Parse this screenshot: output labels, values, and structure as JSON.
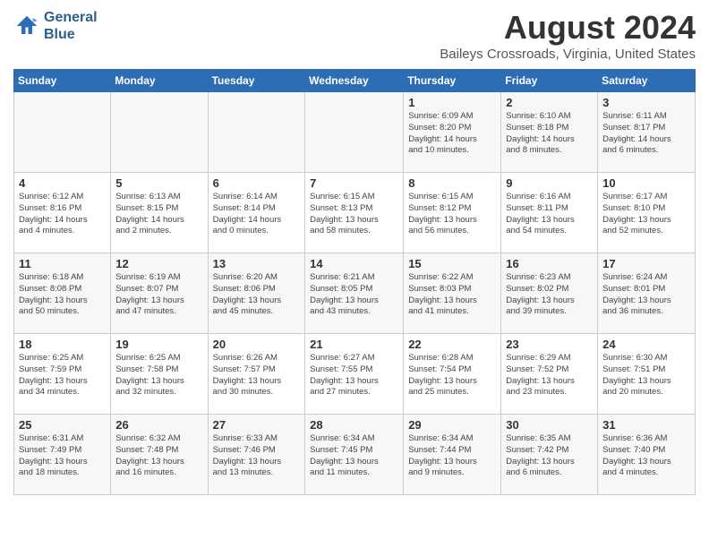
{
  "logo": {
    "line1": "General",
    "line2": "Blue"
  },
  "title": "August 2024",
  "location": "Baileys Crossroads, Virginia, United States",
  "days_of_week": [
    "Sunday",
    "Monday",
    "Tuesday",
    "Wednesday",
    "Thursday",
    "Friday",
    "Saturday"
  ],
  "weeks": [
    [
      {
        "day": "",
        "text": ""
      },
      {
        "day": "",
        "text": ""
      },
      {
        "day": "",
        "text": ""
      },
      {
        "day": "",
        "text": ""
      },
      {
        "day": "1",
        "text": "Sunrise: 6:09 AM\nSunset: 8:20 PM\nDaylight: 14 hours\nand 10 minutes."
      },
      {
        "day": "2",
        "text": "Sunrise: 6:10 AM\nSunset: 8:18 PM\nDaylight: 14 hours\nand 8 minutes."
      },
      {
        "day": "3",
        "text": "Sunrise: 6:11 AM\nSunset: 8:17 PM\nDaylight: 14 hours\nand 6 minutes."
      }
    ],
    [
      {
        "day": "4",
        "text": "Sunrise: 6:12 AM\nSunset: 8:16 PM\nDaylight: 14 hours\nand 4 minutes."
      },
      {
        "day": "5",
        "text": "Sunrise: 6:13 AM\nSunset: 8:15 PM\nDaylight: 14 hours\nand 2 minutes."
      },
      {
        "day": "6",
        "text": "Sunrise: 6:14 AM\nSunset: 8:14 PM\nDaylight: 14 hours\nand 0 minutes."
      },
      {
        "day": "7",
        "text": "Sunrise: 6:15 AM\nSunset: 8:13 PM\nDaylight: 13 hours\nand 58 minutes."
      },
      {
        "day": "8",
        "text": "Sunrise: 6:15 AM\nSunset: 8:12 PM\nDaylight: 13 hours\nand 56 minutes."
      },
      {
        "day": "9",
        "text": "Sunrise: 6:16 AM\nSunset: 8:11 PM\nDaylight: 13 hours\nand 54 minutes."
      },
      {
        "day": "10",
        "text": "Sunrise: 6:17 AM\nSunset: 8:10 PM\nDaylight: 13 hours\nand 52 minutes."
      }
    ],
    [
      {
        "day": "11",
        "text": "Sunrise: 6:18 AM\nSunset: 8:08 PM\nDaylight: 13 hours\nand 50 minutes."
      },
      {
        "day": "12",
        "text": "Sunrise: 6:19 AM\nSunset: 8:07 PM\nDaylight: 13 hours\nand 47 minutes."
      },
      {
        "day": "13",
        "text": "Sunrise: 6:20 AM\nSunset: 8:06 PM\nDaylight: 13 hours\nand 45 minutes."
      },
      {
        "day": "14",
        "text": "Sunrise: 6:21 AM\nSunset: 8:05 PM\nDaylight: 13 hours\nand 43 minutes."
      },
      {
        "day": "15",
        "text": "Sunrise: 6:22 AM\nSunset: 8:03 PM\nDaylight: 13 hours\nand 41 minutes."
      },
      {
        "day": "16",
        "text": "Sunrise: 6:23 AM\nSunset: 8:02 PM\nDaylight: 13 hours\nand 39 minutes."
      },
      {
        "day": "17",
        "text": "Sunrise: 6:24 AM\nSunset: 8:01 PM\nDaylight: 13 hours\nand 36 minutes."
      }
    ],
    [
      {
        "day": "18",
        "text": "Sunrise: 6:25 AM\nSunset: 7:59 PM\nDaylight: 13 hours\nand 34 minutes."
      },
      {
        "day": "19",
        "text": "Sunrise: 6:25 AM\nSunset: 7:58 PM\nDaylight: 13 hours\nand 32 minutes."
      },
      {
        "day": "20",
        "text": "Sunrise: 6:26 AM\nSunset: 7:57 PM\nDaylight: 13 hours\nand 30 minutes."
      },
      {
        "day": "21",
        "text": "Sunrise: 6:27 AM\nSunset: 7:55 PM\nDaylight: 13 hours\nand 27 minutes."
      },
      {
        "day": "22",
        "text": "Sunrise: 6:28 AM\nSunset: 7:54 PM\nDaylight: 13 hours\nand 25 minutes."
      },
      {
        "day": "23",
        "text": "Sunrise: 6:29 AM\nSunset: 7:52 PM\nDaylight: 13 hours\nand 23 minutes."
      },
      {
        "day": "24",
        "text": "Sunrise: 6:30 AM\nSunset: 7:51 PM\nDaylight: 13 hours\nand 20 minutes."
      }
    ],
    [
      {
        "day": "25",
        "text": "Sunrise: 6:31 AM\nSunset: 7:49 PM\nDaylight: 13 hours\nand 18 minutes."
      },
      {
        "day": "26",
        "text": "Sunrise: 6:32 AM\nSunset: 7:48 PM\nDaylight: 13 hours\nand 16 minutes."
      },
      {
        "day": "27",
        "text": "Sunrise: 6:33 AM\nSunset: 7:46 PM\nDaylight: 13 hours\nand 13 minutes."
      },
      {
        "day": "28",
        "text": "Sunrise: 6:34 AM\nSunset: 7:45 PM\nDaylight: 13 hours\nand 11 minutes."
      },
      {
        "day": "29",
        "text": "Sunrise: 6:34 AM\nSunset: 7:44 PM\nDaylight: 13 hours\nand 9 minutes."
      },
      {
        "day": "30",
        "text": "Sunrise: 6:35 AM\nSunset: 7:42 PM\nDaylight: 13 hours\nand 6 minutes."
      },
      {
        "day": "31",
        "text": "Sunrise: 6:36 AM\nSunset: 7:40 PM\nDaylight: 13 hours\nand 4 minutes."
      }
    ]
  ]
}
